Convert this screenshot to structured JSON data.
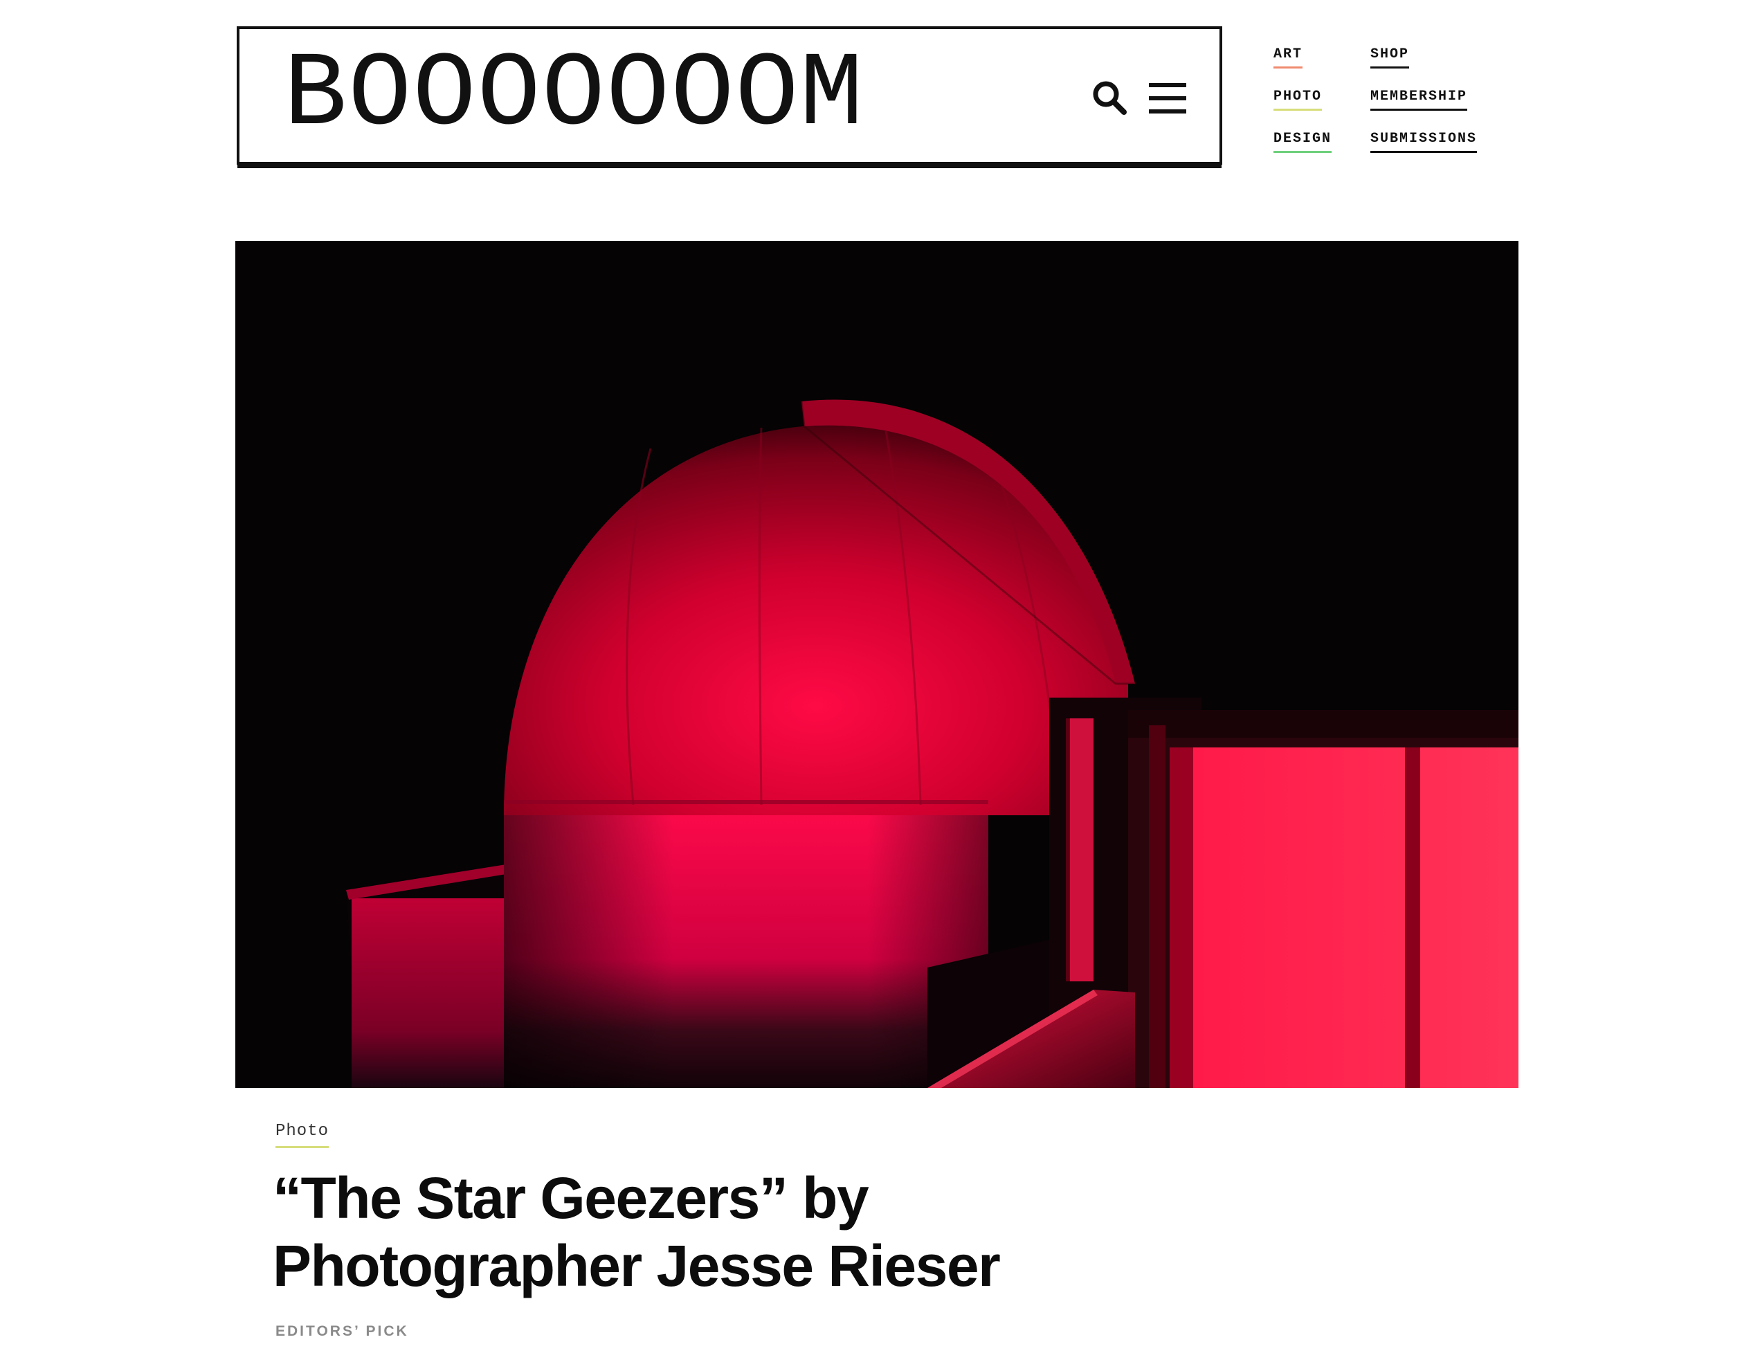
{
  "site": {
    "logo": "BOOOOOOOM"
  },
  "header": {
    "search_icon": "search-icon",
    "menu_icon": "hamburger-menu-icon"
  },
  "nav": {
    "col1": [
      {
        "label": "ART",
        "color": "#f08a6e"
      },
      {
        "label": "PHOTO",
        "color": "#d7dd7a"
      },
      {
        "label": "DESIGN",
        "color": "#6fd07c"
      }
    ],
    "col2": [
      {
        "label": "SHOP"
      },
      {
        "label": "MEMBERSHIP"
      },
      {
        "label": "SUBMISSIONS"
      }
    ]
  },
  "article": {
    "category": "Photo",
    "title": "“The Star Geezers” by Photographer Jesse Rieser",
    "kicker": "EDITORS’ PICK"
  },
  "colors": {
    "background": "#ffffff",
    "text": "#111111",
    "hero_red": "#e8003c"
  }
}
